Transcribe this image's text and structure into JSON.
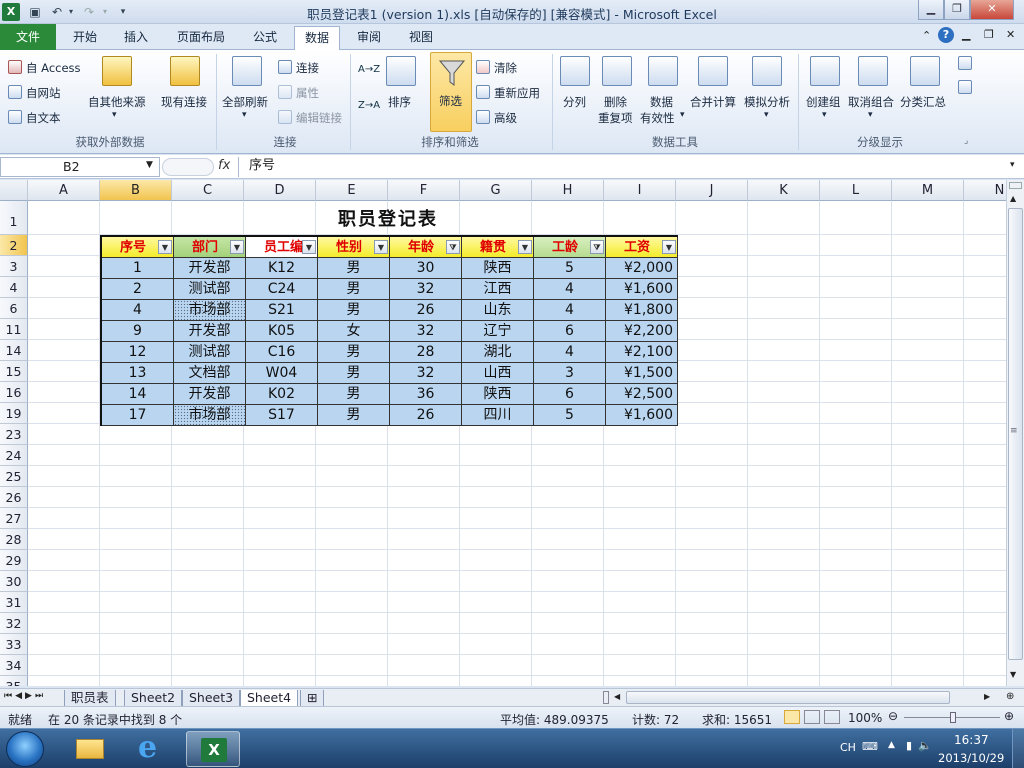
{
  "window": {
    "title": "职员登记表1 (version 1).xls [自动保存的] [兼容模式] - Microsoft Excel"
  },
  "tabs": [
    "文件",
    "开始",
    "插入",
    "页面布局",
    "公式",
    "数据",
    "审阅",
    "视图"
  ],
  "active_tab": "数据",
  "ribbon": {
    "get_external": {
      "access": "自 Access",
      "web": "自网站",
      "text": "自文本",
      "other": "自其他来源",
      "existing": "现有连接",
      "label": "获取外部数据"
    },
    "connections": {
      "refresh_all": "全部刷新",
      "connections": "连接",
      "properties": "属性",
      "edit_links": "编辑链接",
      "label": "连接"
    },
    "sort_filter": {
      "sort": "排序",
      "filter": "筛选",
      "clear": "清除",
      "reapply": "重新应用",
      "advanced": "高级",
      "label": "排序和筛选",
      "sort_az": "A→Z",
      "sort_za": "Z→A"
    },
    "data_tools": {
      "text_to_columns": "分列",
      "remove_dup_1": "删除",
      "remove_dup_2": "重复项",
      "validation_1": "数据",
      "validation_2": "有效性",
      "consolidate": "合并计算",
      "what_if": "模拟分析",
      "label": "数据工具"
    },
    "outline": {
      "group": "创建组",
      "ungroup": "取消组合",
      "subtotal": "分类汇总",
      "label": "分级显示"
    }
  },
  "formula_bar": {
    "name_box": "B2",
    "fx": "fx",
    "value": "序号"
  },
  "columns": [
    "A",
    "B",
    "C",
    "D",
    "E",
    "F",
    "G",
    "H",
    "I",
    "J",
    "K",
    "L",
    "M",
    "N"
  ],
  "row_headers": [
    "1",
    "2",
    "3",
    "4",
    "6",
    "11",
    "14",
    "15",
    "16",
    "19",
    "23",
    "24",
    "25",
    "26",
    "27",
    "28",
    "29",
    "30",
    "31",
    "32",
    "33",
    "34",
    "35"
  ],
  "sheet": {
    "title": "职员登记表",
    "headers": [
      "序号",
      "部门",
      "员工编",
      "性别",
      "年龄",
      "籍贯",
      "工龄",
      "工资"
    ],
    "rows": [
      [
        "1",
        "开发部",
        "K12",
        "男",
        "30",
        "陕西",
        "5",
        "¥2,000"
      ],
      [
        "2",
        "测试部",
        "C24",
        "男",
        "32",
        "江西",
        "4",
        "¥1,600"
      ],
      [
        "4",
        "市场部",
        "S21",
        "男",
        "26",
        "山东",
        "4",
        "¥1,800"
      ],
      [
        "9",
        "开发部",
        "K05",
        "女",
        "32",
        "辽宁",
        "6",
        "¥2,200"
      ],
      [
        "12",
        "测试部",
        "C16",
        "男",
        "28",
        "湖北",
        "4",
        "¥2,100"
      ],
      [
        "13",
        "文档部",
        "W04",
        "男",
        "32",
        "山西",
        "3",
        "¥1,500"
      ],
      [
        "14",
        "开发部",
        "K02",
        "男",
        "36",
        "陕西",
        "6",
        "¥2,500"
      ],
      [
        "17",
        "市场部",
        "S17",
        "男",
        "26",
        "四川",
        "5",
        "¥1,600"
      ]
    ]
  },
  "sheet_tabs": [
    "职员表",
    "Sheet2",
    "Sheet3",
    "Sheet4"
  ],
  "active_sheet": "Sheet4",
  "status": {
    "ready": "就绪",
    "filter_msg": "在 20 条记录中找到 8 个",
    "average": "平均值: 489.09375",
    "count": "计数: 72",
    "sum": "求和: 15651",
    "zoom": "100%"
  },
  "taskbar": {
    "lang": "CH",
    "time": "16:37",
    "date": "2013/10/29"
  },
  "colors": {
    "table_fill": "#b9d5f0",
    "header_yellow": "#f4ec2a",
    "header_green": "#a4d17a",
    "header_text": "#e00000",
    "accent": "#2a8a3a"
  }
}
